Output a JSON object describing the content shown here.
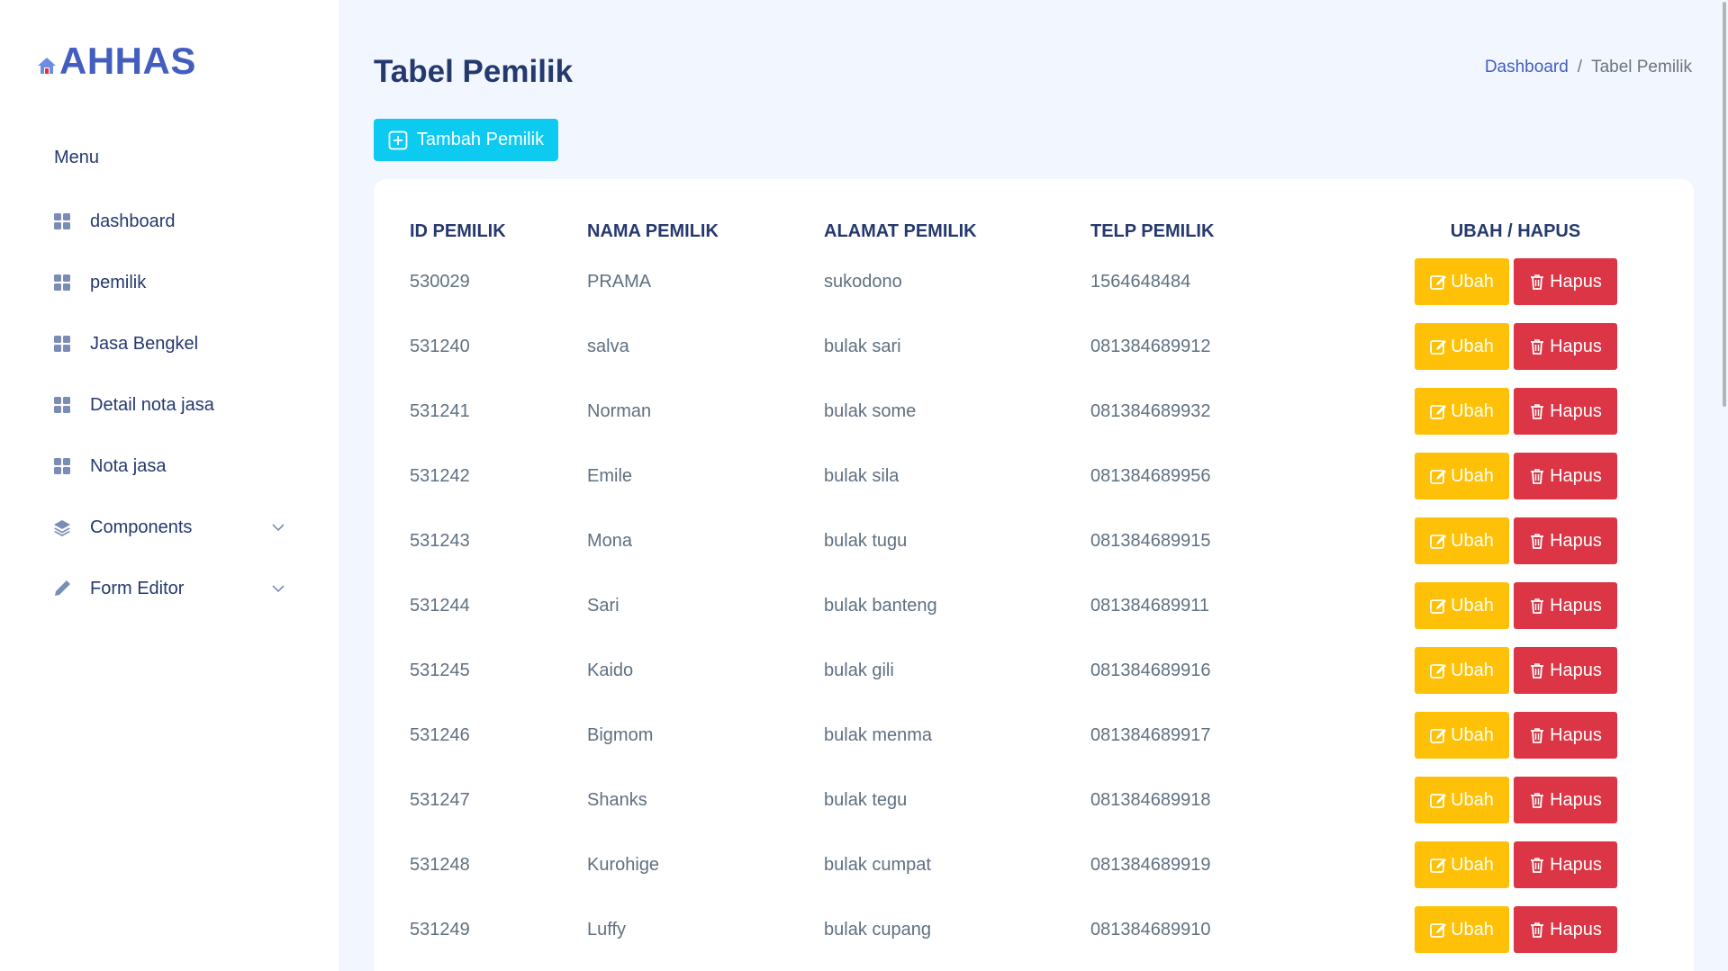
{
  "app": {
    "logo_text": "AHHAS"
  },
  "sidebar": {
    "menu_title": "Menu",
    "items": [
      {
        "label": "dashboard",
        "icon": "grid-icon",
        "has_submenu": false
      },
      {
        "label": "pemilik",
        "icon": "grid-icon",
        "has_submenu": false
      },
      {
        "label": "Jasa Bengkel",
        "icon": "grid-icon",
        "has_submenu": false
      },
      {
        "label": "Detail nota jasa",
        "icon": "grid-icon",
        "has_submenu": false
      },
      {
        "label": "Nota jasa",
        "icon": "grid-icon",
        "has_submenu": false
      },
      {
        "label": "Components",
        "icon": "layers-icon",
        "has_submenu": true
      },
      {
        "label": "Form Editor",
        "icon": "pen-icon",
        "has_submenu": true
      }
    ]
  },
  "page": {
    "title": "Tabel Pemilik",
    "breadcrumb": {
      "home": "Dashboard",
      "separator": "/",
      "current": "Tabel Pemilik"
    },
    "add_button": "Tambah Pemilik"
  },
  "table": {
    "headers": [
      "ID PEMILIK",
      "NAMA PEMILIK",
      "ALAMAT PEMILIK",
      "TELP PEMILIK",
      "UBAH / HAPUS"
    ],
    "edit_label": "Ubah",
    "delete_label": "Hapus",
    "rows": [
      [
        "530029",
        "PRAMA",
        "sukodono",
        "1564648484"
      ],
      [
        "531240",
        "salva",
        "bulak sari",
        "081384689912"
      ],
      [
        "531241",
        "Norman",
        "bulak some",
        "081384689932"
      ],
      [
        "531242",
        "Emile",
        "bulak sila",
        "081384689956"
      ],
      [
        "531243",
        "Mona",
        "bulak tugu",
        "081384689915"
      ],
      [
        "531244",
        "Sari",
        "bulak banteng",
        "081384689911"
      ],
      [
        "531245",
        "Kaido",
        "bulak gili",
        "081384689916"
      ],
      [
        "531246",
        "Bigmom",
        "bulak menma",
        "081384689917"
      ],
      [
        "531247",
        "Shanks",
        "bulak tegu",
        "081384689918"
      ],
      [
        "531248",
        "Kurohige",
        "bulak cumpat",
        "081384689919"
      ],
      [
        "531249",
        "Luffy",
        "bulak cupang",
        "081384689910"
      ]
    ]
  },
  "colors": {
    "primary": "#435ebe",
    "text": "#25396f",
    "info": "#0dcaf0",
    "warning": "#ffc107",
    "danger": "#dc3545",
    "background": "#f2f7ff"
  }
}
